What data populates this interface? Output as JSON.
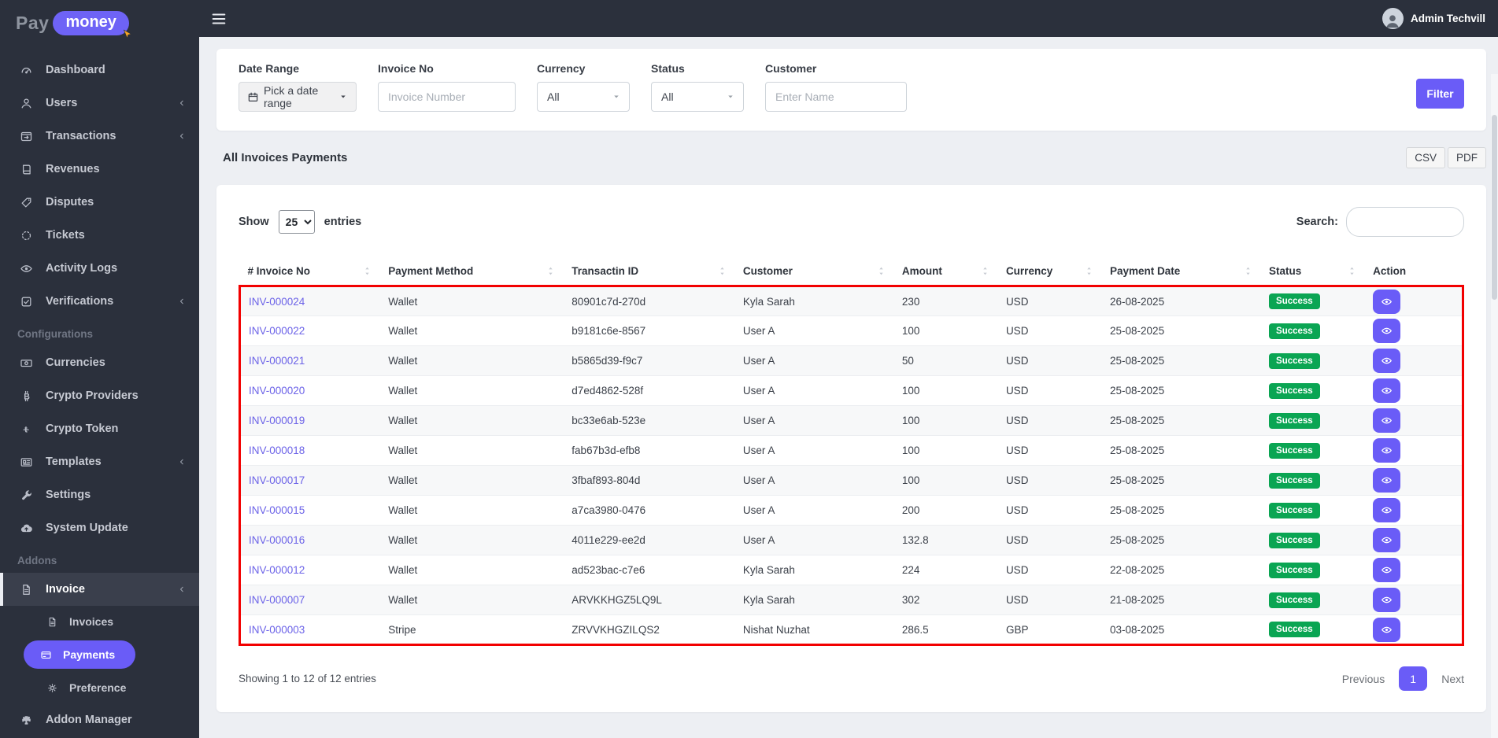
{
  "brand": {
    "pay": "Pay",
    "money": "money"
  },
  "topbar": {
    "user_name": "Admin Techvill"
  },
  "colors": {
    "accent": "#6a5cf7",
    "success": "#0aa553",
    "highlight_border": "#f20000",
    "sidebar_bg": "#2b303c"
  },
  "sidebar": {
    "items": [
      {
        "type": "item",
        "label": "Dashboard",
        "icon": "dashboard-icon"
      },
      {
        "type": "item",
        "label": "Users",
        "icon": "user-icon",
        "chevron": true
      },
      {
        "type": "item",
        "label": "Transactions",
        "icon": "transactions-icon",
        "chevron": true
      },
      {
        "type": "item",
        "label": "Revenues",
        "icon": "book-icon"
      },
      {
        "type": "item",
        "label": "Disputes",
        "icon": "ticket-icon"
      },
      {
        "type": "item",
        "label": "Tickets",
        "icon": "dotted-circle-icon"
      },
      {
        "type": "item",
        "label": "Activity Logs",
        "icon": "eye-icon"
      },
      {
        "type": "item",
        "label": "Verifications",
        "icon": "check-square-icon",
        "chevron": true
      },
      {
        "type": "section",
        "label": "Configurations"
      },
      {
        "type": "item",
        "label": "Currencies",
        "icon": "bill-icon"
      },
      {
        "type": "item",
        "label": "Crypto Providers",
        "icon": "bitcoin-icon"
      },
      {
        "type": "item",
        "label": "Crypto Token",
        "icon": "token-icon"
      },
      {
        "type": "item",
        "label": "Templates",
        "icon": "newspaper-icon",
        "chevron": true
      },
      {
        "type": "item",
        "label": "Settings",
        "icon": "wrench-icon"
      },
      {
        "type": "item",
        "label": "System Update",
        "icon": "cloud-upload-icon"
      },
      {
        "type": "section",
        "label": "Addons"
      },
      {
        "type": "item",
        "label": "Invoice",
        "icon": "invoice-icon",
        "chevron": true,
        "active": true
      },
      {
        "type": "subitem",
        "label": "Invoices",
        "icon": "file-icon"
      },
      {
        "type": "subitem",
        "label": "Payments",
        "icon": "card-icon",
        "active": true
      },
      {
        "type": "subitem",
        "label": "Preference",
        "icon": "gears-icon"
      },
      {
        "type": "item",
        "label": "Addon Manager",
        "icon": "puzzle-icon"
      }
    ]
  },
  "filters": {
    "date_range": {
      "label": "Date Range",
      "value": "Pick a date range"
    },
    "invoice_no": {
      "label": "Invoice No",
      "placeholder": "Invoice Number"
    },
    "currency": {
      "label": "Currency",
      "value": "All"
    },
    "status": {
      "label": "Status",
      "value": "All"
    },
    "customer": {
      "label": "Customer",
      "placeholder": "Enter Name"
    },
    "filter_button": "Filter"
  },
  "content": {
    "title": "All Invoices Payments",
    "export_buttons": [
      "CSV",
      "PDF"
    ],
    "show_label": "Show",
    "page_length": "25",
    "entries_label": "entries",
    "search_label": "Search:",
    "table": {
      "columns": [
        {
          "label": "# Invoice No",
          "sortable": true
        },
        {
          "label": "Payment Method",
          "sortable": true
        },
        {
          "label": "Transactin ID",
          "sortable": true
        },
        {
          "label": "Customer",
          "sortable": true
        },
        {
          "label": "Amount",
          "sortable": true
        },
        {
          "label": "Currency",
          "sortable": true
        },
        {
          "label": "Payment Date",
          "sortable": true
        },
        {
          "label": "Status",
          "sortable": true
        },
        {
          "label": "Action",
          "sortable": false
        }
      ],
      "rows": [
        {
          "invoice_no": "INV-000024",
          "method": "Wallet",
          "txn_id": "80901c7d-270d",
          "customer": "Kyla Sarah",
          "amount": "230",
          "currency": "USD",
          "date": "26-08-2025",
          "status": "Success"
        },
        {
          "invoice_no": "INV-000022",
          "method": "Wallet",
          "txn_id": "b9181c6e-8567",
          "customer": "User A",
          "amount": "100",
          "currency": "USD",
          "date": "25-08-2025",
          "status": "Success"
        },
        {
          "invoice_no": "INV-000021",
          "method": "Wallet",
          "txn_id": "b5865d39-f9c7",
          "customer": "User A",
          "amount": "50",
          "currency": "USD",
          "date": "25-08-2025",
          "status": "Success"
        },
        {
          "invoice_no": "INV-000020",
          "method": "Wallet",
          "txn_id": "d7ed4862-528f",
          "customer": "User A",
          "amount": "100",
          "currency": "USD",
          "date": "25-08-2025",
          "status": "Success"
        },
        {
          "invoice_no": "INV-000019",
          "method": "Wallet",
          "txn_id": "bc33e6ab-523e",
          "customer": "User A",
          "amount": "100",
          "currency": "USD",
          "date": "25-08-2025",
          "status": "Success"
        },
        {
          "invoice_no": "INV-000018",
          "method": "Wallet",
          "txn_id": "fab67b3d-efb8",
          "customer": "User A",
          "amount": "100",
          "currency": "USD",
          "date": "25-08-2025",
          "status": "Success"
        },
        {
          "invoice_no": "INV-000017",
          "method": "Wallet",
          "txn_id": "3fbaf893-804d",
          "customer": "User A",
          "amount": "100",
          "currency": "USD",
          "date": "25-08-2025",
          "status": "Success"
        },
        {
          "invoice_no": "INV-000015",
          "method": "Wallet",
          "txn_id": "a7ca3980-0476",
          "customer": "User A",
          "amount": "200",
          "currency": "USD",
          "date": "25-08-2025",
          "status": "Success"
        },
        {
          "invoice_no": "INV-000016",
          "method": "Wallet",
          "txn_id": "4011e229-ee2d",
          "customer": "User A",
          "amount": "132.8",
          "currency": "USD",
          "date": "25-08-2025",
          "status": "Success"
        },
        {
          "invoice_no": "INV-000012",
          "method": "Wallet",
          "txn_id": "ad523bac-c7e6",
          "customer": "Kyla Sarah",
          "amount": "224",
          "currency": "USD",
          "date": "22-08-2025",
          "status": "Success"
        },
        {
          "invoice_no": "INV-000007",
          "method": "Wallet",
          "txn_id": "ARVKKHGZ5LQ9L",
          "customer": "Kyla Sarah",
          "amount": "302",
          "currency": "USD",
          "date": "21-08-2025",
          "status": "Success"
        },
        {
          "invoice_no": "INV-000003",
          "method": "Stripe",
          "txn_id": "ZRVVKHGZILQS2",
          "customer": "Nishat Nuzhat",
          "amount": "286.5",
          "currency": "GBP",
          "date": "03-08-2025",
          "status": "Success"
        }
      ]
    },
    "footer": {
      "info": "Showing 1 to 12 of 12 entries",
      "previous": "Previous",
      "current_page": "1",
      "next": "Next"
    }
  }
}
